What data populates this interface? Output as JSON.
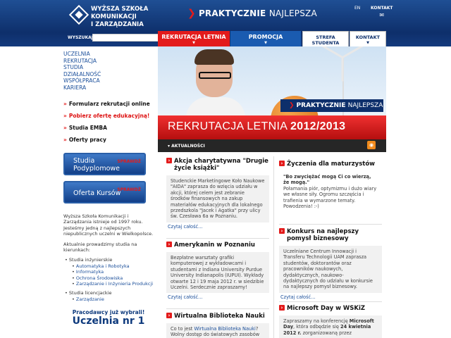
{
  "header": {
    "logo_line1": "WYŻSZA SZKOŁA",
    "logo_line2": "KOMUNIKACJI",
    "logo_line3": "I ZARZĄDZANIA",
    "tagline_bold": "PRAKTYCZNIE",
    "tagline_light": "NAJLEPSZA",
    "lang": "EN",
    "kontakt": "KONTAKT",
    "search_label": "WYSZUKAJ",
    "search_value": "",
    "search_go": "»"
  },
  "tabs": [
    {
      "label": "REKRUTACJA LETNIA"
    },
    {
      "label": "PROMOCJA"
    },
    {
      "label": "STREFA STUDENTA"
    },
    {
      "label": "KONTAKT"
    }
  ],
  "leftmenu": [
    "UCZELNIA",
    "REKRUTACJA",
    "STUDIA",
    "DZIAŁALNOŚĆ",
    "WSPÓŁPRACA",
    "KARIERA"
  ],
  "promos": [
    {
      "label": "Formularz rekrutacji online"
    },
    {
      "label": "Pobierz ofertę edukacyjną!"
    },
    {
      "label": "Studia EMBA"
    },
    {
      "label": "Oferty pracy"
    }
  ],
  "bigbuttons": [
    {
      "line1": "Studia",
      "line2": "Podyplomowe",
      "tag": "SPRAWDŹ"
    },
    {
      "line1": "Oferta Kursów",
      "line2": "",
      "tag": "SPRAWDŹ"
    }
  ],
  "about": {
    "p1": "Wyższa Szkoła Komunikacji i Zarządzania istnieje od 1997 roku. Jesteśmy jedną z najlepszych niepublicznych uczelni w Wielkopolsce.",
    "p2": "Aktualnie prowadzimy studia na kierunkach:",
    "top1": "Studia inżynierskie",
    "sub1": "Automatyka i Robotyka",
    "sub2": "Informatyka",
    "sub3": "Ochrona Środowiska",
    "sub4": "Zarządzanie i Inżynieria Produkcji",
    "top2": "Studia licencjackie",
    "sub5": "Zarządzanie"
  },
  "bottombox": {
    "l1": "Pracodawcy już wybrali!",
    "l2": "Uczelnia nr 1"
  },
  "banner": {
    "tag_bold": "PRAKTYCZNIE",
    "tag_light": "NAJLEPSZA",
    "red_light": "REKRUTACJA LETNIA",
    "red_bold": "2012/2013",
    "dark": "AKTUALNOŚCI"
  },
  "news": [
    {
      "title": "Akcja charytatywna \"Drugie życie książki\"",
      "body": "Studenckie Marketingowe Koło Naukowe \"AIDA\" zaprasza do wzięcia udziału w akcji, której celem jest zebranie środków finansowych na zakup materiałów edukacyjnych dla lokalnego przedszkola \"Jacek i Agatka\" przy ulicy św. Czesława 6a w Poznaniu.",
      "more": "Czytaj całość..."
    },
    {
      "title": "Amerykanin w Poznaniu",
      "body": "Bezpłatne warsztaty grafiki komputerowej z wykładowcami i studentami z Indiana University Purdue University Indianapolis (IUPUI). Wykłady otwarte 12 i 19 maja 2012 r. w siedzibie Uczelni. Serdecznie zapraszamy!",
      "more": "Czytaj całość..."
    },
    {
      "title": "Wirtualna Biblioteka Nauki",
      "body_pre": "Co to jest ",
      "body_link": "Wirtualna Biblioteka Nauki",
      "body_post": "? Wolny dostęp do światowych zasobów",
      "more": ""
    },
    {
      "title": "Życzenia dla maturzystów",
      "quote": "\"Bo zwyciężać mogą Ci co wierzą, że mogą.\"",
      "body": "Połamania piór, optymizmu i dużo wiary we własne siły. Ogromu szczęścia i trafienia w wymarzone tematy. Powodzenia! :-)",
      "more": ""
    },
    {
      "title": "Konkurs na najlepszy pomysł biznesowy",
      "body": "Uczelniane Centrum Innowacji i Transferu Technologii UAM zaprasza studentów, doktorantów oraz pracowników naukowych, dydaktycznych, naukowo-dydaktycznych do udziału w konkursie na najlepszy pomysł biznesowy.",
      "more": "Czytaj całość..."
    },
    {
      "title": "Microsoft Day w WSKiZ",
      "body_pre": "Zapraszamy na konferencję ",
      "body_b1": "Microsoft Day",
      "body_mid": ", która odbędzie się ",
      "body_b2": "24 kwietnia 2012 r.",
      "body_post": " zorganizowaną przez",
      "more": ""
    }
  ],
  "colors": {
    "brand_blue": "#0e2f6b",
    "accent_red": "#e31b1b",
    "link_blue": "#1a4e9a"
  }
}
